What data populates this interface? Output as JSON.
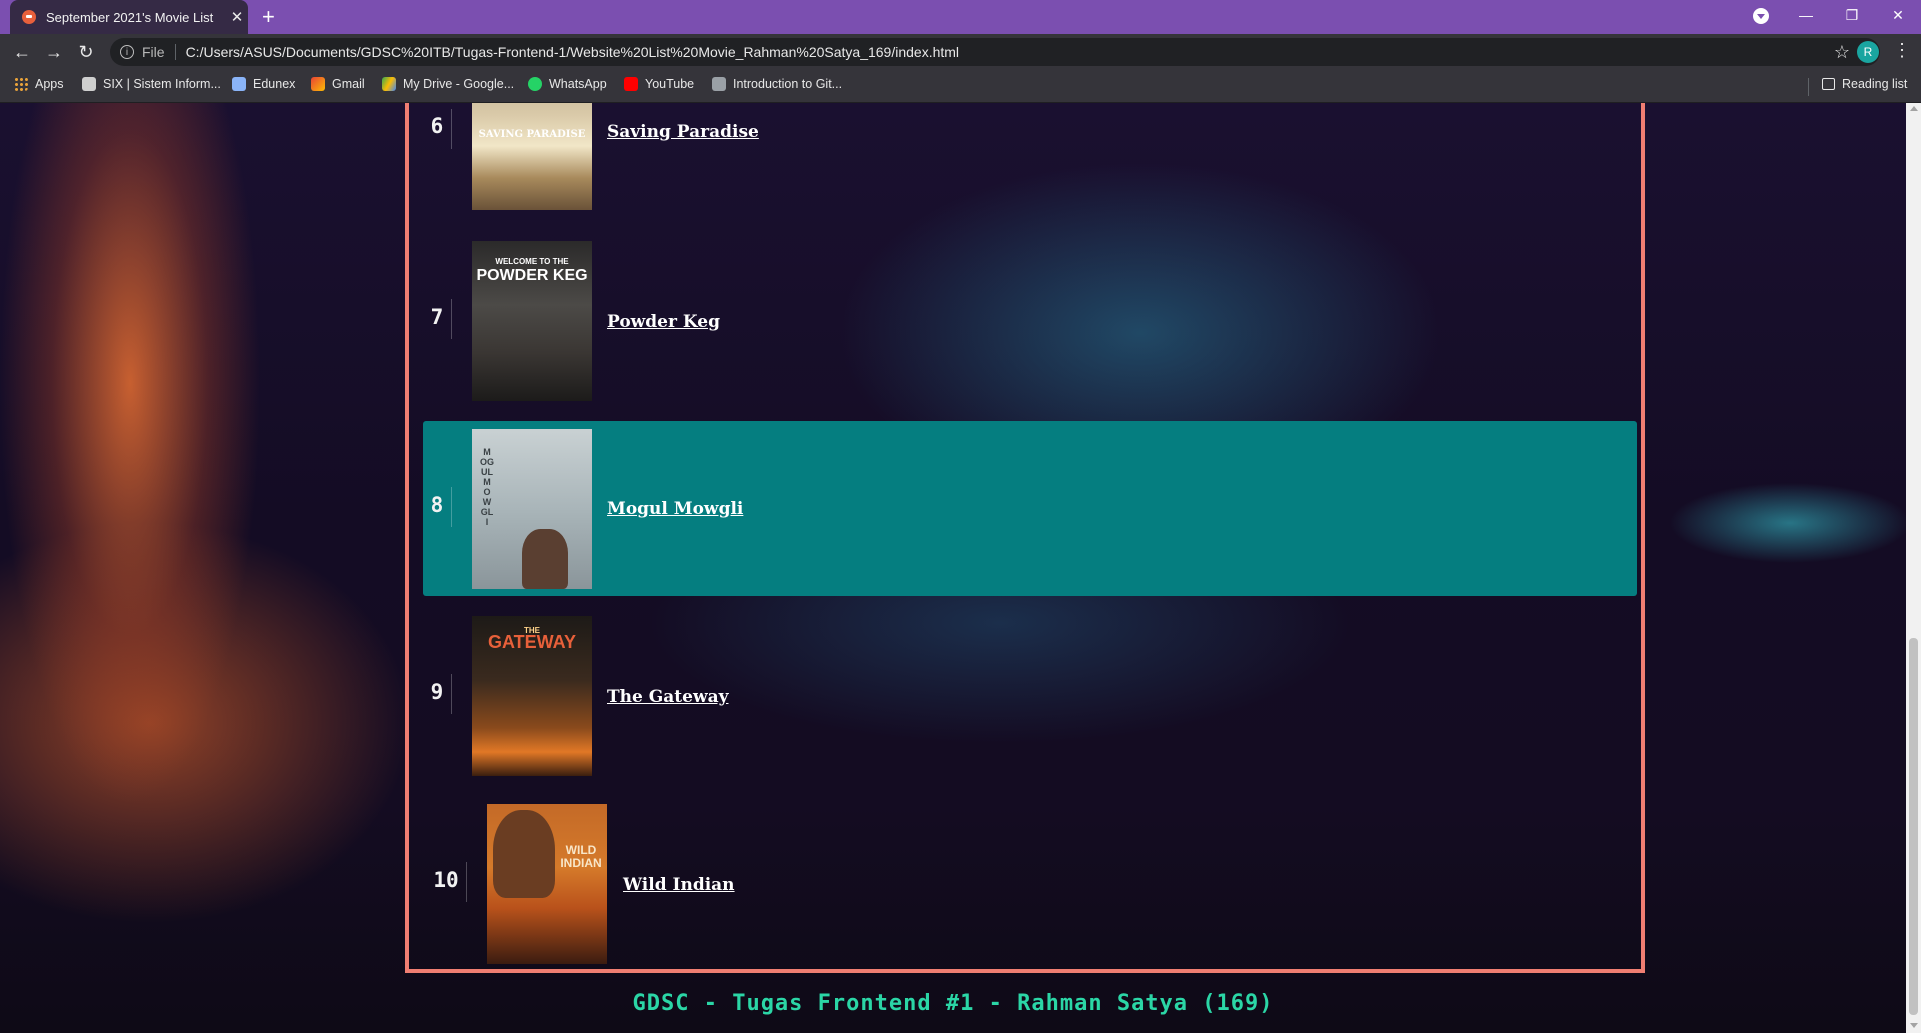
{
  "browser": {
    "tab_title": "September 2021's Movie List",
    "tab_close": "✕",
    "new_tab": "+",
    "address_prefix": "File",
    "url": "C:/Users/ASUS/Documents/GDSC%20ITB/Tugas-Frontend-1/Website%20List%20Movie_Rahman%20Satya_169/index.html",
    "avatar_letter": "R",
    "bookmarks": [
      {
        "label": "Apps",
        "icon": "apps-grid-icon",
        "color": "#e8a23a"
      },
      {
        "label": "SIX | Sistem Inform...",
        "icon": "six-itb-icon",
        "color": "#cfcfcf"
      },
      {
        "label": "Edunex",
        "icon": "edunex-icon",
        "color": "#8ab4f8"
      },
      {
        "label": "Gmail",
        "icon": "gmail-icon",
        "color": "#ea4335"
      },
      {
        "label": "My Drive - Google...",
        "icon": "google-drive-icon",
        "color": "#fbbc04"
      },
      {
        "label": "WhatsApp",
        "icon": "whatsapp-icon",
        "color": "#25d366"
      },
      {
        "label": "YouTube",
        "icon": "youtube-icon",
        "color": "#ff0000"
      },
      {
        "label": "Introduction to Git...",
        "icon": "git-page-icon",
        "color": "#9aa0a6"
      }
    ],
    "reading_list": "Reading list"
  },
  "movies": [
    {
      "rank": "6",
      "title": "Saving Paradise",
      "poster_caption": "SAVING PARADISE",
      "active": false
    },
    {
      "rank": "7",
      "title": "Powder Keg",
      "poster_caption": "POWDER KEG",
      "poster_kicker": "WELCOME TO THE",
      "active": false
    },
    {
      "rank": "8",
      "title": "Mogul Mowgli",
      "poster_caption": "MOGUL MOWGLI",
      "active": true
    },
    {
      "rank": "9",
      "title": "The Gateway",
      "poster_caption": "GATEWAY",
      "poster_kicker": "THE",
      "active": false
    },
    {
      "rank": "10",
      "title": "Wild Indian",
      "poster_caption": "WILD INDIAN",
      "active": false
    }
  ],
  "footer": "GDSC - Tugas Frontend #1 - Rahman Satya (169)",
  "colors": {
    "frame_border": "#f07e72",
    "active_row": "#057e80",
    "footer_text": "#2bd6a6",
    "tabstrip": "#7b4fb0"
  }
}
